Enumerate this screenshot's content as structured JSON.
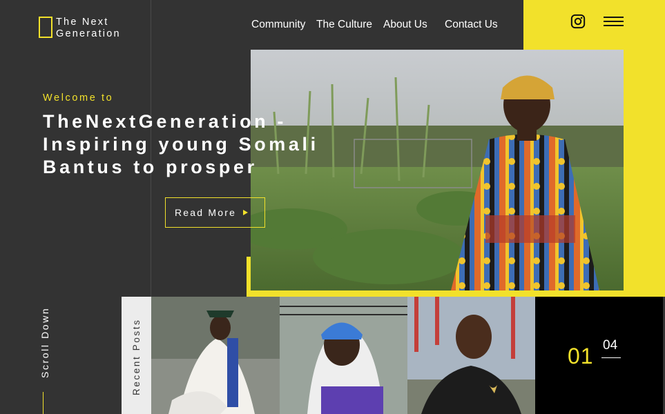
{
  "brand": {
    "line1": "The Next",
    "line2": "Generation"
  },
  "nav": {
    "items": [
      {
        "label": "Community"
      },
      {
        "label": "The Culture"
      },
      {
        "label": "About Us"
      },
      {
        "label": "Contact Us"
      }
    ]
  },
  "header_icons": {
    "instagram": "instagram-icon",
    "menu": "hamburger-menu-icon"
  },
  "hero": {
    "welcome": "Welcome to",
    "headline_line1": "TheNextGeneration -",
    "headline_line2": "Inspiring young Somali",
    "headline_line3": "Bantus to prosper",
    "cta": "Read More"
  },
  "scroll_hint": "Scroll Down",
  "recent": {
    "label": "Recent Posts"
  },
  "pager": {
    "current": "01",
    "total": "04"
  },
  "colors": {
    "accent": "#f2e12b",
    "background": "#333333",
    "panel": "#000000"
  }
}
